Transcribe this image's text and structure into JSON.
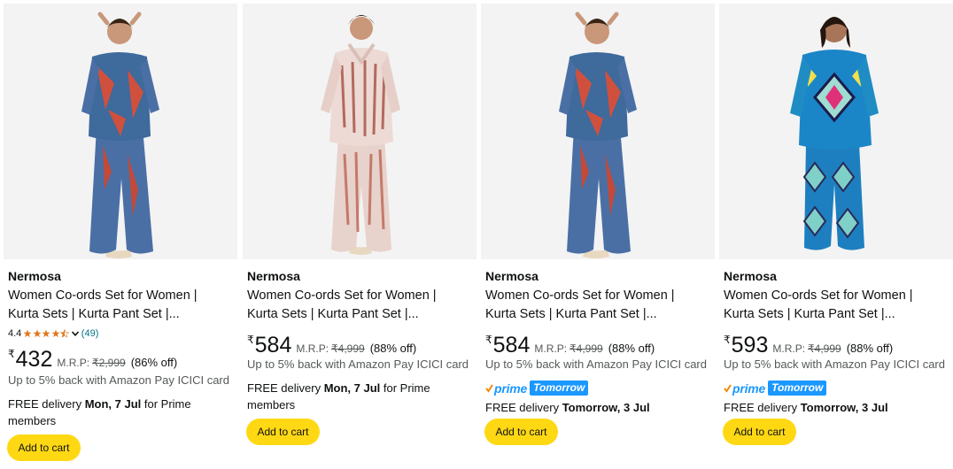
{
  "colors": {
    "accent": "#ffd814",
    "link": "#007185",
    "prime": "#1a98ff",
    "star": "#de7921"
  },
  "products": [
    {
      "brand": "Nermosa",
      "title_line1": "Women Co-ords Set for Women |",
      "title_line2": "Kurta Sets | Kurta Pant Set |...",
      "rating_value": "4.4",
      "rating_stars": 4.4,
      "rating_count": "(49)",
      "currency": "₹",
      "price": "432",
      "mrp_label": "M.R.P:",
      "mrp": "₹2,999",
      "discount": "(86% off)",
      "cashback": "Up to 5% back with Amazon Pay ICICI card",
      "delivery_prefix": "FREE delivery",
      "delivery_date": "Mon, 7 Jul",
      "delivery_suffix": "for Prime members",
      "add_to_cart": "Add to cart"
    },
    {
      "brand": "Nermosa",
      "title_line1": "Women Co-ords Set for Women |",
      "title_line2": "Kurta Sets | Kurta Pant Set |...",
      "currency": "₹",
      "price": "584",
      "mrp_label": "M.R.P:",
      "mrp": "₹4,999",
      "discount": "(88% off)",
      "cashback": "Up to 5% back with Amazon Pay ICICI card",
      "delivery_prefix": "FREE delivery",
      "delivery_date": "Mon, 7 Jul",
      "delivery_suffix": "for Prime members",
      "add_to_cart": "Add to cart"
    },
    {
      "brand": "Nermosa",
      "title_line1": "Women Co-ords Set for Women |",
      "title_line2": "Kurta Sets | Kurta Pant Set |...",
      "currency": "₹",
      "price": "584",
      "mrp_label": "M.R.P:",
      "mrp": "₹4,999",
      "discount": "(88% off)",
      "cashback": "Up to 5% back with Amazon Pay ICICI card",
      "prime_label": "prime",
      "prime_badge": "Tomorrow",
      "delivery_prefix": "FREE delivery",
      "delivery_date": "Tomorrow, 3 Jul",
      "add_to_cart": "Add to cart"
    },
    {
      "brand": "Nermosa",
      "title_line1": "Women Co-ords Set for Women |",
      "title_line2": "Kurta Sets | Kurta Pant Set |...",
      "currency": "₹",
      "price": "593",
      "mrp_label": "M.R.P:",
      "mrp": "₹4,999",
      "discount": "(88% off)",
      "cashback": "Up to 5% back with Amazon Pay ICICI card",
      "prime_label": "prime",
      "prime_badge": "Tomorrow",
      "delivery_prefix": "FREE delivery",
      "delivery_date": "Tomorrow, 3 Jul",
      "add_to_cart": "Add to cart"
    }
  ]
}
